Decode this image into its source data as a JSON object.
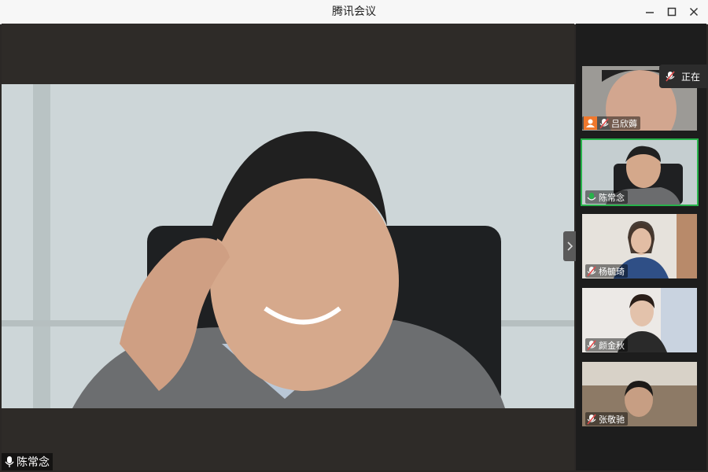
{
  "window": {
    "title": "腾讯会议"
  },
  "main_speaker": {
    "name": "陈常念",
    "mic": "mic-on-icon"
  },
  "speaking_indicator": {
    "label": "正在"
  },
  "participants": [
    {
      "name": "吕欣薅",
      "mic": "mic-muted-icon",
      "active": false
    },
    {
      "name": "陈常念",
      "mic": "mic-on-icon",
      "active": true
    },
    {
      "name": "杨毓琦",
      "mic": "mic-muted-icon",
      "active": false
    },
    {
      "name": "颜金秋",
      "mic": "mic-muted-icon",
      "active": false
    },
    {
      "name": "张敬驰",
      "mic": "mic-muted-icon",
      "active": false
    }
  ],
  "colors": {
    "active_border": "#27b24a",
    "mic_on": "#27b24a",
    "mic_muted": "#e04b4b",
    "host_badge": "#f0782d"
  }
}
